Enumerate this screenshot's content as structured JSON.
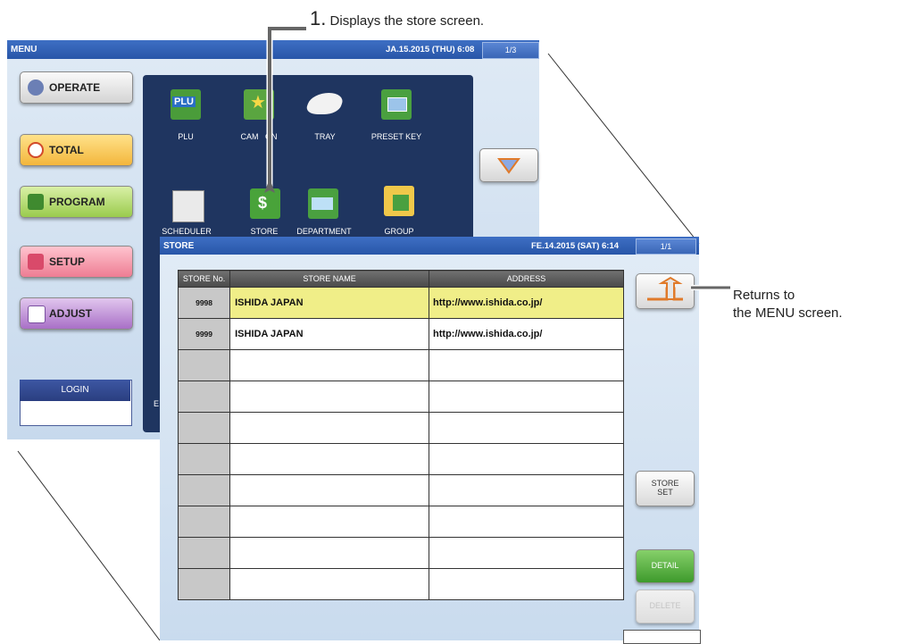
{
  "menu_screen": {
    "title": "MENU",
    "datetime": "JA.15.2015 (THU)  6:08",
    "page": "1/3",
    "buttons": [
      {
        "label": "OPERATE"
      },
      {
        "label": "TOTAL"
      },
      {
        "label": "PROGRAM"
      },
      {
        "label": "SETUP"
      },
      {
        "label": "ADJUST"
      }
    ],
    "login_label": "LOGIN",
    "icons": [
      {
        "label": "PLU"
      },
      {
        "label": "CAMPAIGN",
        "visible_text": "CAM   GN"
      },
      {
        "label": "TRAY"
      },
      {
        "label": "PRESET KEY"
      },
      {
        "label": "SCHEDULER"
      },
      {
        "label": "STORE"
      },
      {
        "label": "DEPARTMENT"
      },
      {
        "label": "GROUP"
      }
    ],
    "partial_text": "E"
  },
  "store_screen": {
    "title": "STORE",
    "datetime": "FE.14.2015 (SAT)  6:14",
    "page": "1/1",
    "columns": [
      "STORE No.",
      "STORE NAME",
      "ADDRESS"
    ],
    "rows": [
      {
        "no": "9998",
        "name": "ISHIDA JAPAN",
        "address": "http://www.ishida.co.jp/",
        "selected": true
      },
      {
        "no": "9999",
        "name": "ISHIDA JAPAN",
        "address": "http://www.ishida.co.jp/",
        "selected": false
      },
      {
        "no": "",
        "name": "",
        "address": ""
      },
      {
        "no": "",
        "name": "",
        "address": ""
      },
      {
        "no": "",
        "name": "",
        "address": ""
      },
      {
        "no": "",
        "name": "",
        "address": ""
      },
      {
        "no": "",
        "name": "",
        "address": ""
      },
      {
        "no": "",
        "name": "",
        "address": ""
      },
      {
        "no": "",
        "name": "",
        "address": ""
      },
      {
        "no": "",
        "name": "",
        "address": ""
      }
    ],
    "store_set_line1": "STORE",
    "store_set_line2": "SET",
    "detail_label": "DETAIL",
    "delete_label": "DELETE"
  },
  "annotations": {
    "step_number": "1.",
    "step_text": "Displays the store screen.",
    "return_line1": "Returns to",
    "return_line2": "the MENU screen."
  },
  "colors": {
    "titlebar": "#2f60b6",
    "selected_row": "#f0ee88",
    "detail_green": "#4ba537",
    "icon_panel": "#1f3560"
  }
}
